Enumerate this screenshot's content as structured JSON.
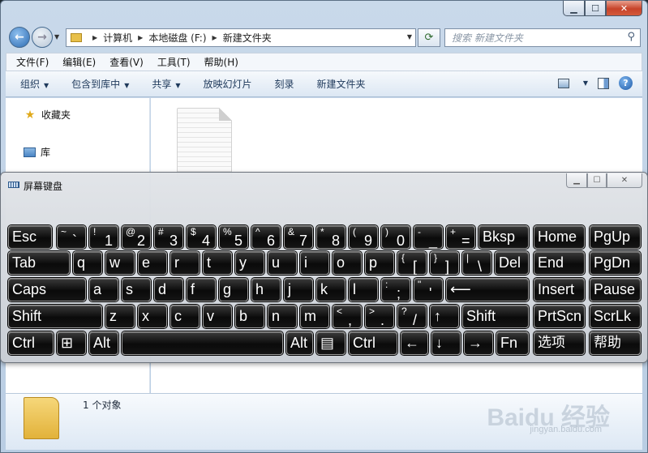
{
  "explorer": {
    "breadcrumb": [
      "计算机",
      "本地磁盘 (F:)",
      "新建文件夹"
    ],
    "search_placeholder": "搜索 新建文件夹",
    "menu": [
      "文件(F)",
      "编辑(E)",
      "查看(V)",
      "工具(T)",
      "帮助(H)"
    ],
    "commands": [
      {
        "label": "组织",
        "dropdown": true
      },
      {
        "label": "包含到库中",
        "dropdown": true
      },
      {
        "label": "共享",
        "dropdown": true
      },
      {
        "label": "放映幻灯片",
        "dropdown": false
      },
      {
        "label": "刻录",
        "dropdown": false
      },
      {
        "label": "新建文件夹",
        "dropdown": false
      }
    ],
    "nav": {
      "favorites": "收藏夹",
      "libraries": "库"
    },
    "status": "1 个对象",
    "watermark": "Baidu 经验",
    "watermark_sub": "jingyan.baidu.com"
  },
  "osk": {
    "title": "屏幕键盘",
    "rows": [
      [
        {
          "id": "esc",
          "main": "Esc"
        },
        {
          "id": "tilde",
          "shift": "~",
          "main": "`"
        },
        {
          "id": "1",
          "shift": "!",
          "main": "1"
        },
        {
          "id": "2",
          "shift": "@",
          "main": "2"
        },
        {
          "id": "3",
          "shift": "#",
          "main": "3"
        },
        {
          "id": "4",
          "shift": "$",
          "main": "4"
        },
        {
          "id": "5",
          "shift": "%",
          "main": "5"
        },
        {
          "id": "6",
          "shift": "^",
          "main": "6"
        },
        {
          "id": "7",
          "shift": "&",
          "main": "7"
        },
        {
          "id": "8",
          "shift": "*",
          "main": "8"
        },
        {
          "id": "9",
          "shift": "(",
          "main": "9"
        },
        {
          "id": "0",
          "shift": ")",
          "main": "0"
        },
        {
          "id": "minus",
          "shift": "-",
          "main": "_"
        },
        {
          "id": "equals",
          "shift": "+",
          "main": "="
        },
        {
          "id": "bksp",
          "main": "Bksp"
        },
        {
          "id": "home",
          "main": "Home"
        },
        {
          "id": "pgup",
          "main": "PgUp"
        }
      ],
      [
        {
          "id": "tab",
          "main": "Tab"
        },
        {
          "id": "q",
          "main": "q"
        },
        {
          "id": "w",
          "main": "w"
        },
        {
          "id": "e",
          "main": "e"
        },
        {
          "id": "r",
          "main": "r"
        },
        {
          "id": "t",
          "main": "t"
        },
        {
          "id": "y",
          "main": "y"
        },
        {
          "id": "u",
          "main": "u"
        },
        {
          "id": "i",
          "main": "i"
        },
        {
          "id": "o",
          "main": "o"
        },
        {
          "id": "p",
          "main": "p"
        },
        {
          "id": "lbracket",
          "shift": "{",
          "main": "["
        },
        {
          "id": "rbracket",
          "shift": "}",
          "main": "]"
        },
        {
          "id": "backslash",
          "shift": "|",
          "main": "\\"
        },
        {
          "id": "del",
          "main": "Del"
        },
        {
          "id": "end",
          "main": "End"
        },
        {
          "id": "pgdn",
          "main": "PgDn"
        }
      ],
      [
        {
          "id": "caps",
          "main": "Caps"
        },
        {
          "id": "a",
          "main": "a"
        },
        {
          "id": "s",
          "main": "s"
        },
        {
          "id": "d",
          "main": "d"
        },
        {
          "id": "f",
          "main": "f"
        },
        {
          "id": "g",
          "main": "g"
        },
        {
          "id": "h",
          "main": "h"
        },
        {
          "id": "j",
          "main": "j"
        },
        {
          "id": "k",
          "main": "k"
        },
        {
          "id": "l",
          "main": "l"
        },
        {
          "id": "semicolon",
          "shift": ":",
          "main": ";"
        },
        {
          "id": "quote",
          "shift": "\"",
          "main": "'"
        },
        {
          "id": "enter",
          "main": "⟵"
        },
        {
          "id": "insert",
          "main": "Insert"
        },
        {
          "id": "pause",
          "main": "Pause"
        }
      ],
      [
        {
          "id": "lshift",
          "main": "Shift"
        },
        {
          "id": "z",
          "main": "z"
        },
        {
          "id": "x",
          "main": "x"
        },
        {
          "id": "c",
          "main": "c"
        },
        {
          "id": "v",
          "main": "v"
        },
        {
          "id": "b",
          "main": "b"
        },
        {
          "id": "n",
          "main": "n"
        },
        {
          "id": "m",
          "main": "m"
        },
        {
          "id": "comma",
          "shift": "<",
          "main": ","
        },
        {
          "id": "period",
          "shift": ">",
          "main": "."
        },
        {
          "id": "slash",
          "shift": "?",
          "main": "/"
        },
        {
          "id": "up",
          "main": "↑"
        },
        {
          "id": "rshift",
          "main": "Shift"
        },
        {
          "id": "prtscn",
          "main": "PrtScn"
        },
        {
          "id": "scrlk",
          "main": "ScrLk"
        }
      ],
      [
        {
          "id": "lctrl",
          "main": "Ctrl"
        },
        {
          "id": "win",
          "main": "⊞"
        },
        {
          "id": "lalt",
          "main": "Alt"
        },
        {
          "id": "space",
          "main": ""
        },
        {
          "id": "ralt",
          "main": "Alt"
        },
        {
          "id": "menu",
          "main": "▤"
        },
        {
          "id": "rctrl",
          "main": "Ctrl"
        },
        {
          "id": "left",
          "main": "←"
        },
        {
          "id": "down",
          "main": "↓"
        },
        {
          "id": "right",
          "main": "→"
        },
        {
          "id": "fn",
          "main": "Fn"
        },
        {
          "id": "options",
          "main": "选项"
        },
        {
          "id": "help",
          "main": "帮助"
        }
      ]
    ]
  }
}
